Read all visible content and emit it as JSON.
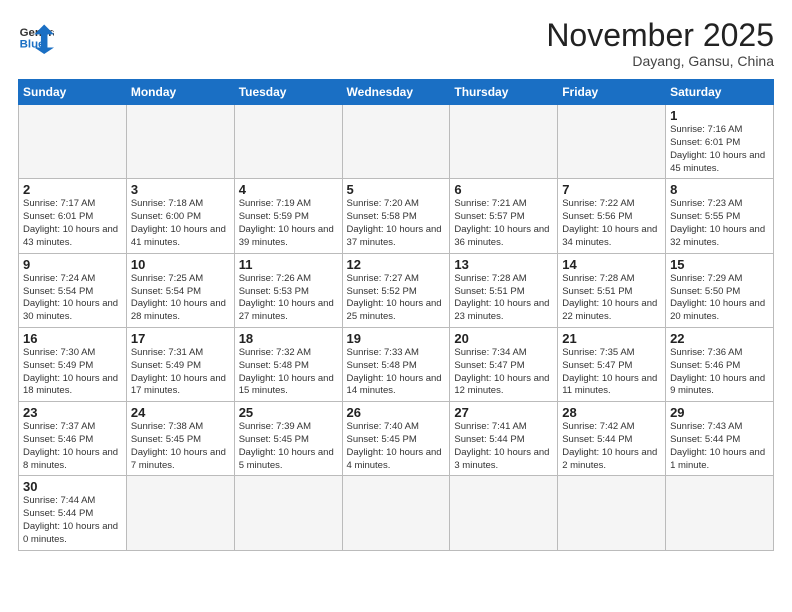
{
  "logo": {
    "general": "General",
    "blue": "Blue"
  },
  "header": {
    "month": "November 2025",
    "location": "Dayang, Gansu, China"
  },
  "weekdays": [
    "Sunday",
    "Monday",
    "Tuesday",
    "Wednesday",
    "Thursday",
    "Friday",
    "Saturday"
  ],
  "weeks": [
    [
      {
        "day": "",
        "info": ""
      },
      {
        "day": "",
        "info": ""
      },
      {
        "day": "",
        "info": ""
      },
      {
        "day": "",
        "info": ""
      },
      {
        "day": "",
        "info": ""
      },
      {
        "day": "",
        "info": ""
      },
      {
        "day": "1",
        "info": "Sunrise: 7:16 AM\nSunset: 6:01 PM\nDaylight: 10 hours\nand 45 minutes."
      }
    ],
    [
      {
        "day": "2",
        "info": "Sunrise: 7:17 AM\nSunset: 6:01 PM\nDaylight: 10 hours\nand 43 minutes."
      },
      {
        "day": "3",
        "info": "Sunrise: 7:18 AM\nSunset: 6:00 PM\nDaylight: 10 hours\nand 41 minutes."
      },
      {
        "day": "4",
        "info": "Sunrise: 7:19 AM\nSunset: 5:59 PM\nDaylight: 10 hours\nand 39 minutes."
      },
      {
        "day": "5",
        "info": "Sunrise: 7:20 AM\nSunset: 5:58 PM\nDaylight: 10 hours\nand 37 minutes."
      },
      {
        "day": "6",
        "info": "Sunrise: 7:21 AM\nSunset: 5:57 PM\nDaylight: 10 hours\nand 36 minutes."
      },
      {
        "day": "7",
        "info": "Sunrise: 7:22 AM\nSunset: 5:56 PM\nDaylight: 10 hours\nand 34 minutes."
      },
      {
        "day": "8",
        "info": "Sunrise: 7:23 AM\nSunset: 5:55 PM\nDaylight: 10 hours\nand 32 minutes."
      }
    ],
    [
      {
        "day": "9",
        "info": "Sunrise: 7:24 AM\nSunset: 5:54 PM\nDaylight: 10 hours\nand 30 minutes."
      },
      {
        "day": "10",
        "info": "Sunrise: 7:25 AM\nSunset: 5:54 PM\nDaylight: 10 hours\nand 28 minutes."
      },
      {
        "day": "11",
        "info": "Sunrise: 7:26 AM\nSunset: 5:53 PM\nDaylight: 10 hours\nand 27 minutes."
      },
      {
        "day": "12",
        "info": "Sunrise: 7:27 AM\nSunset: 5:52 PM\nDaylight: 10 hours\nand 25 minutes."
      },
      {
        "day": "13",
        "info": "Sunrise: 7:28 AM\nSunset: 5:51 PM\nDaylight: 10 hours\nand 23 minutes."
      },
      {
        "day": "14",
        "info": "Sunrise: 7:28 AM\nSunset: 5:51 PM\nDaylight: 10 hours\nand 22 minutes."
      },
      {
        "day": "15",
        "info": "Sunrise: 7:29 AM\nSunset: 5:50 PM\nDaylight: 10 hours\nand 20 minutes."
      }
    ],
    [
      {
        "day": "16",
        "info": "Sunrise: 7:30 AM\nSunset: 5:49 PM\nDaylight: 10 hours\nand 18 minutes."
      },
      {
        "day": "17",
        "info": "Sunrise: 7:31 AM\nSunset: 5:49 PM\nDaylight: 10 hours\nand 17 minutes."
      },
      {
        "day": "18",
        "info": "Sunrise: 7:32 AM\nSunset: 5:48 PM\nDaylight: 10 hours\nand 15 minutes."
      },
      {
        "day": "19",
        "info": "Sunrise: 7:33 AM\nSunset: 5:48 PM\nDaylight: 10 hours\nand 14 minutes."
      },
      {
        "day": "20",
        "info": "Sunrise: 7:34 AM\nSunset: 5:47 PM\nDaylight: 10 hours\nand 12 minutes."
      },
      {
        "day": "21",
        "info": "Sunrise: 7:35 AM\nSunset: 5:47 PM\nDaylight: 10 hours\nand 11 minutes."
      },
      {
        "day": "22",
        "info": "Sunrise: 7:36 AM\nSunset: 5:46 PM\nDaylight: 10 hours\nand 9 minutes."
      }
    ],
    [
      {
        "day": "23",
        "info": "Sunrise: 7:37 AM\nSunset: 5:46 PM\nDaylight: 10 hours\nand 8 minutes."
      },
      {
        "day": "24",
        "info": "Sunrise: 7:38 AM\nSunset: 5:45 PM\nDaylight: 10 hours\nand 7 minutes."
      },
      {
        "day": "25",
        "info": "Sunrise: 7:39 AM\nSunset: 5:45 PM\nDaylight: 10 hours\nand 5 minutes."
      },
      {
        "day": "26",
        "info": "Sunrise: 7:40 AM\nSunset: 5:45 PM\nDaylight: 10 hours\nand 4 minutes."
      },
      {
        "day": "27",
        "info": "Sunrise: 7:41 AM\nSunset: 5:44 PM\nDaylight: 10 hours\nand 3 minutes."
      },
      {
        "day": "28",
        "info": "Sunrise: 7:42 AM\nSunset: 5:44 PM\nDaylight: 10 hours\nand 2 minutes."
      },
      {
        "day": "29",
        "info": "Sunrise: 7:43 AM\nSunset: 5:44 PM\nDaylight: 10 hours\nand 1 minute."
      }
    ],
    [
      {
        "day": "30",
        "info": "Sunrise: 7:44 AM\nSunset: 5:44 PM\nDaylight: 10 hours\nand 0 minutes."
      },
      {
        "day": "",
        "info": ""
      },
      {
        "day": "",
        "info": ""
      },
      {
        "day": "",
        "info": ""
      },
      {
        "day": "",
        "info": ""
      },
      {
        "day": "",
        "info": ""
      },
      {
        "day": "",
        "info": ""
      }
    ]
  ]
}
